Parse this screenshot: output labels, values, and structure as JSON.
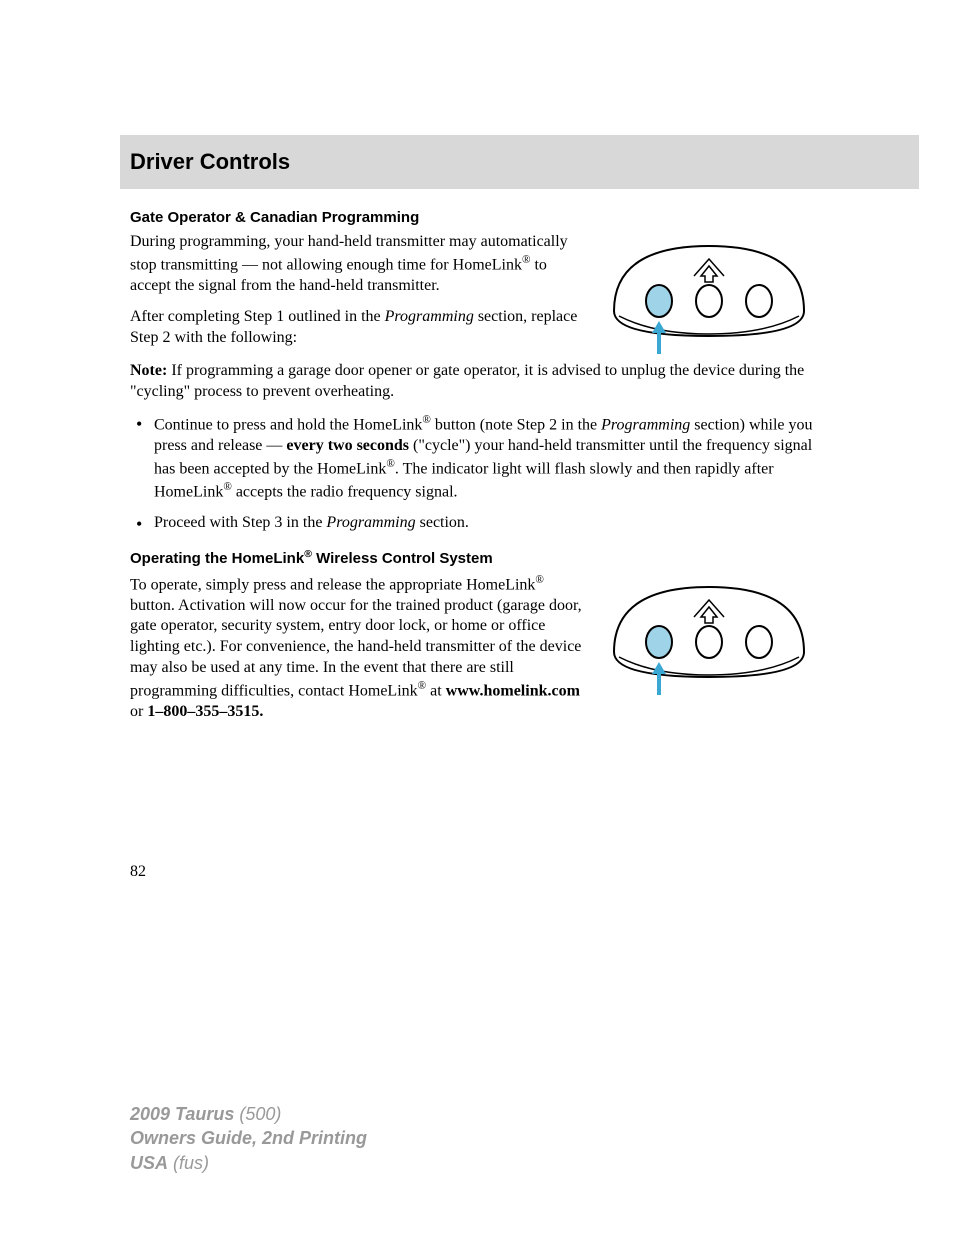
{
  "header": {
    "title": "Driver Controls"
  },
  "section1": {
    "heading": "Gate Operator & Canadian Programming",
    "para1_prefix": "During programming, your hand-held transmitter may automatically stop transmitting — not allowing enough time for HomeLink",
    "para1_suffix": " to accept the signal from the hand-held transmitter.",
    "para2_prefix": "After completing Step 1 outlined in the ",
    "para2_italic": "Programming",
    "para2_suffix": " section, replace Step 2 with the following:",
    "note_label": "Note:",
    "note_text": " If programming a garage door opener or gate operator, it is advised to unplug the device during the \"cycling\" process to prevent overheating.",
    "bullet1_a": "Continue to press and hold the HomeLink",
    "bullet1_b": " button (note Step 2 in the ",
    "bullet1_italic": "Programming",
    "bullet1_c": " section) while you press and release — ",
    "bullet1_bold": "every two seconds",
    "bullet1_d": " (\"cycle\") your hand-held transmitter until the frequency signal has been accepted by the HomeLink",
    "bullet1_e": ". The indicator light will flash slowly and then rapidly after HomeLink",
    "bullet1_f": " accepts the radio frequency signal.",
    "bullet2_a": "Proceed with Step 3 in the ",
    "bullet2_italic": "Programming",
    "bullet2_b": " section."
  },
  "section2": {
    "heading_a": "Operating the HomeLink",
    "heading_b": " Wireless Control System",
    "para1_a": "To operate, simply press and release the appropriate HomeLink",
    "para1_b": " button. Activation will now occur for the trained product (garage door, gate operator, security system, entry door lock, or home or office lighting etc.). For convenience, the hand-held transmitter of the device may also be used at any time. In the event that there are still programming difficulties, contact HomeLink",
    "para1_c": " at ",
    "para1_link": "www.homelink.com",
    "para1_d": " or ",
    "para1_phone": "1–800–355–3515."
  },
  "page_number": "82",
  "footer": {
    "line1_bold": "2009 Taurus",
    "line1_rest": " (500)",
    "line2": "Owners Guide, 2nd Printing",
    "line3_bold": "USA",
    "line3_rest": " (fus)"
  },
  "registered": "®"
}
